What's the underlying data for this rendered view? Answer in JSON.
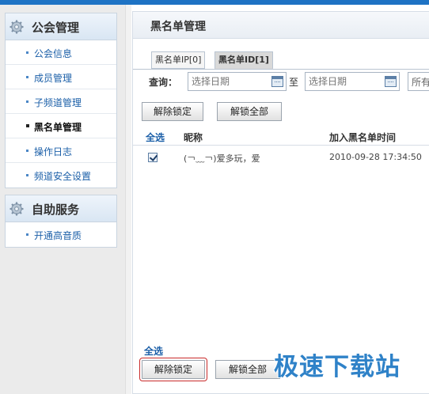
{
  "sidebar": {
    "groups": [
      {
        "title": "公会管理",
        "items": [
          {
            "label": "公会信息"
          },
          {
            "label": "成员管理"
          },
          {
            "label": "子频道管理"
          },
          {
            "label": "黑名单管理"
          },
          {
            "label": "操作日志"
          },
          {
            "label": "频道安全设置"
          }
        ]
      },
      {
        "title": "自助服务",
        "items": [
          {
            "label": "开通高音质"
          }
        ]
      }
    ],
    "active_item": "黑名单管理"
  },
  "main": {
    "title": "黑名单管理",
    "tabs": [
      {
        "label": "黑名单IP[0]",
        "active": false
      },
      {
        "label": "黑名单ID[1]",
        "active": true
      }
    ],
    "query": {
      "label": "查询：",
      "start_placeholder": "选择日期",
      "to_label": "至",
      "end_placeholder": "选择日期",
      "select_value": "所有"
    },
    "buttons": {
      "unlock": "解除锁定",
      "unlock_all": "解锁全部"
    },
    "table": {
      "select_all": "全选",
      "columns": [
        "昵称",
        "加入黑名单时间"
      ],
      "rows": [
        {
          "checked": true,
          "nickname": "(￢﹏￢)爱多玩，爱",
          "time": "2010-09-28 17:34:50"
        }
      ]
    },
    "bottom": {
      "select_all": "全选",
      "unlock": "解除锁定",
      "unlock_all": "解锁全部"
    }
  },
  "watermark": "极速下载站",
  "colors": {
    "accent": "#1e73c4",
    "link": "#1b5fa8",
    "highlight_ring": "#c92b2b"
  },
  "icons": {
    "group_header": "gear-icon",
    "date_picker": "calendar-icon"
  }
}
